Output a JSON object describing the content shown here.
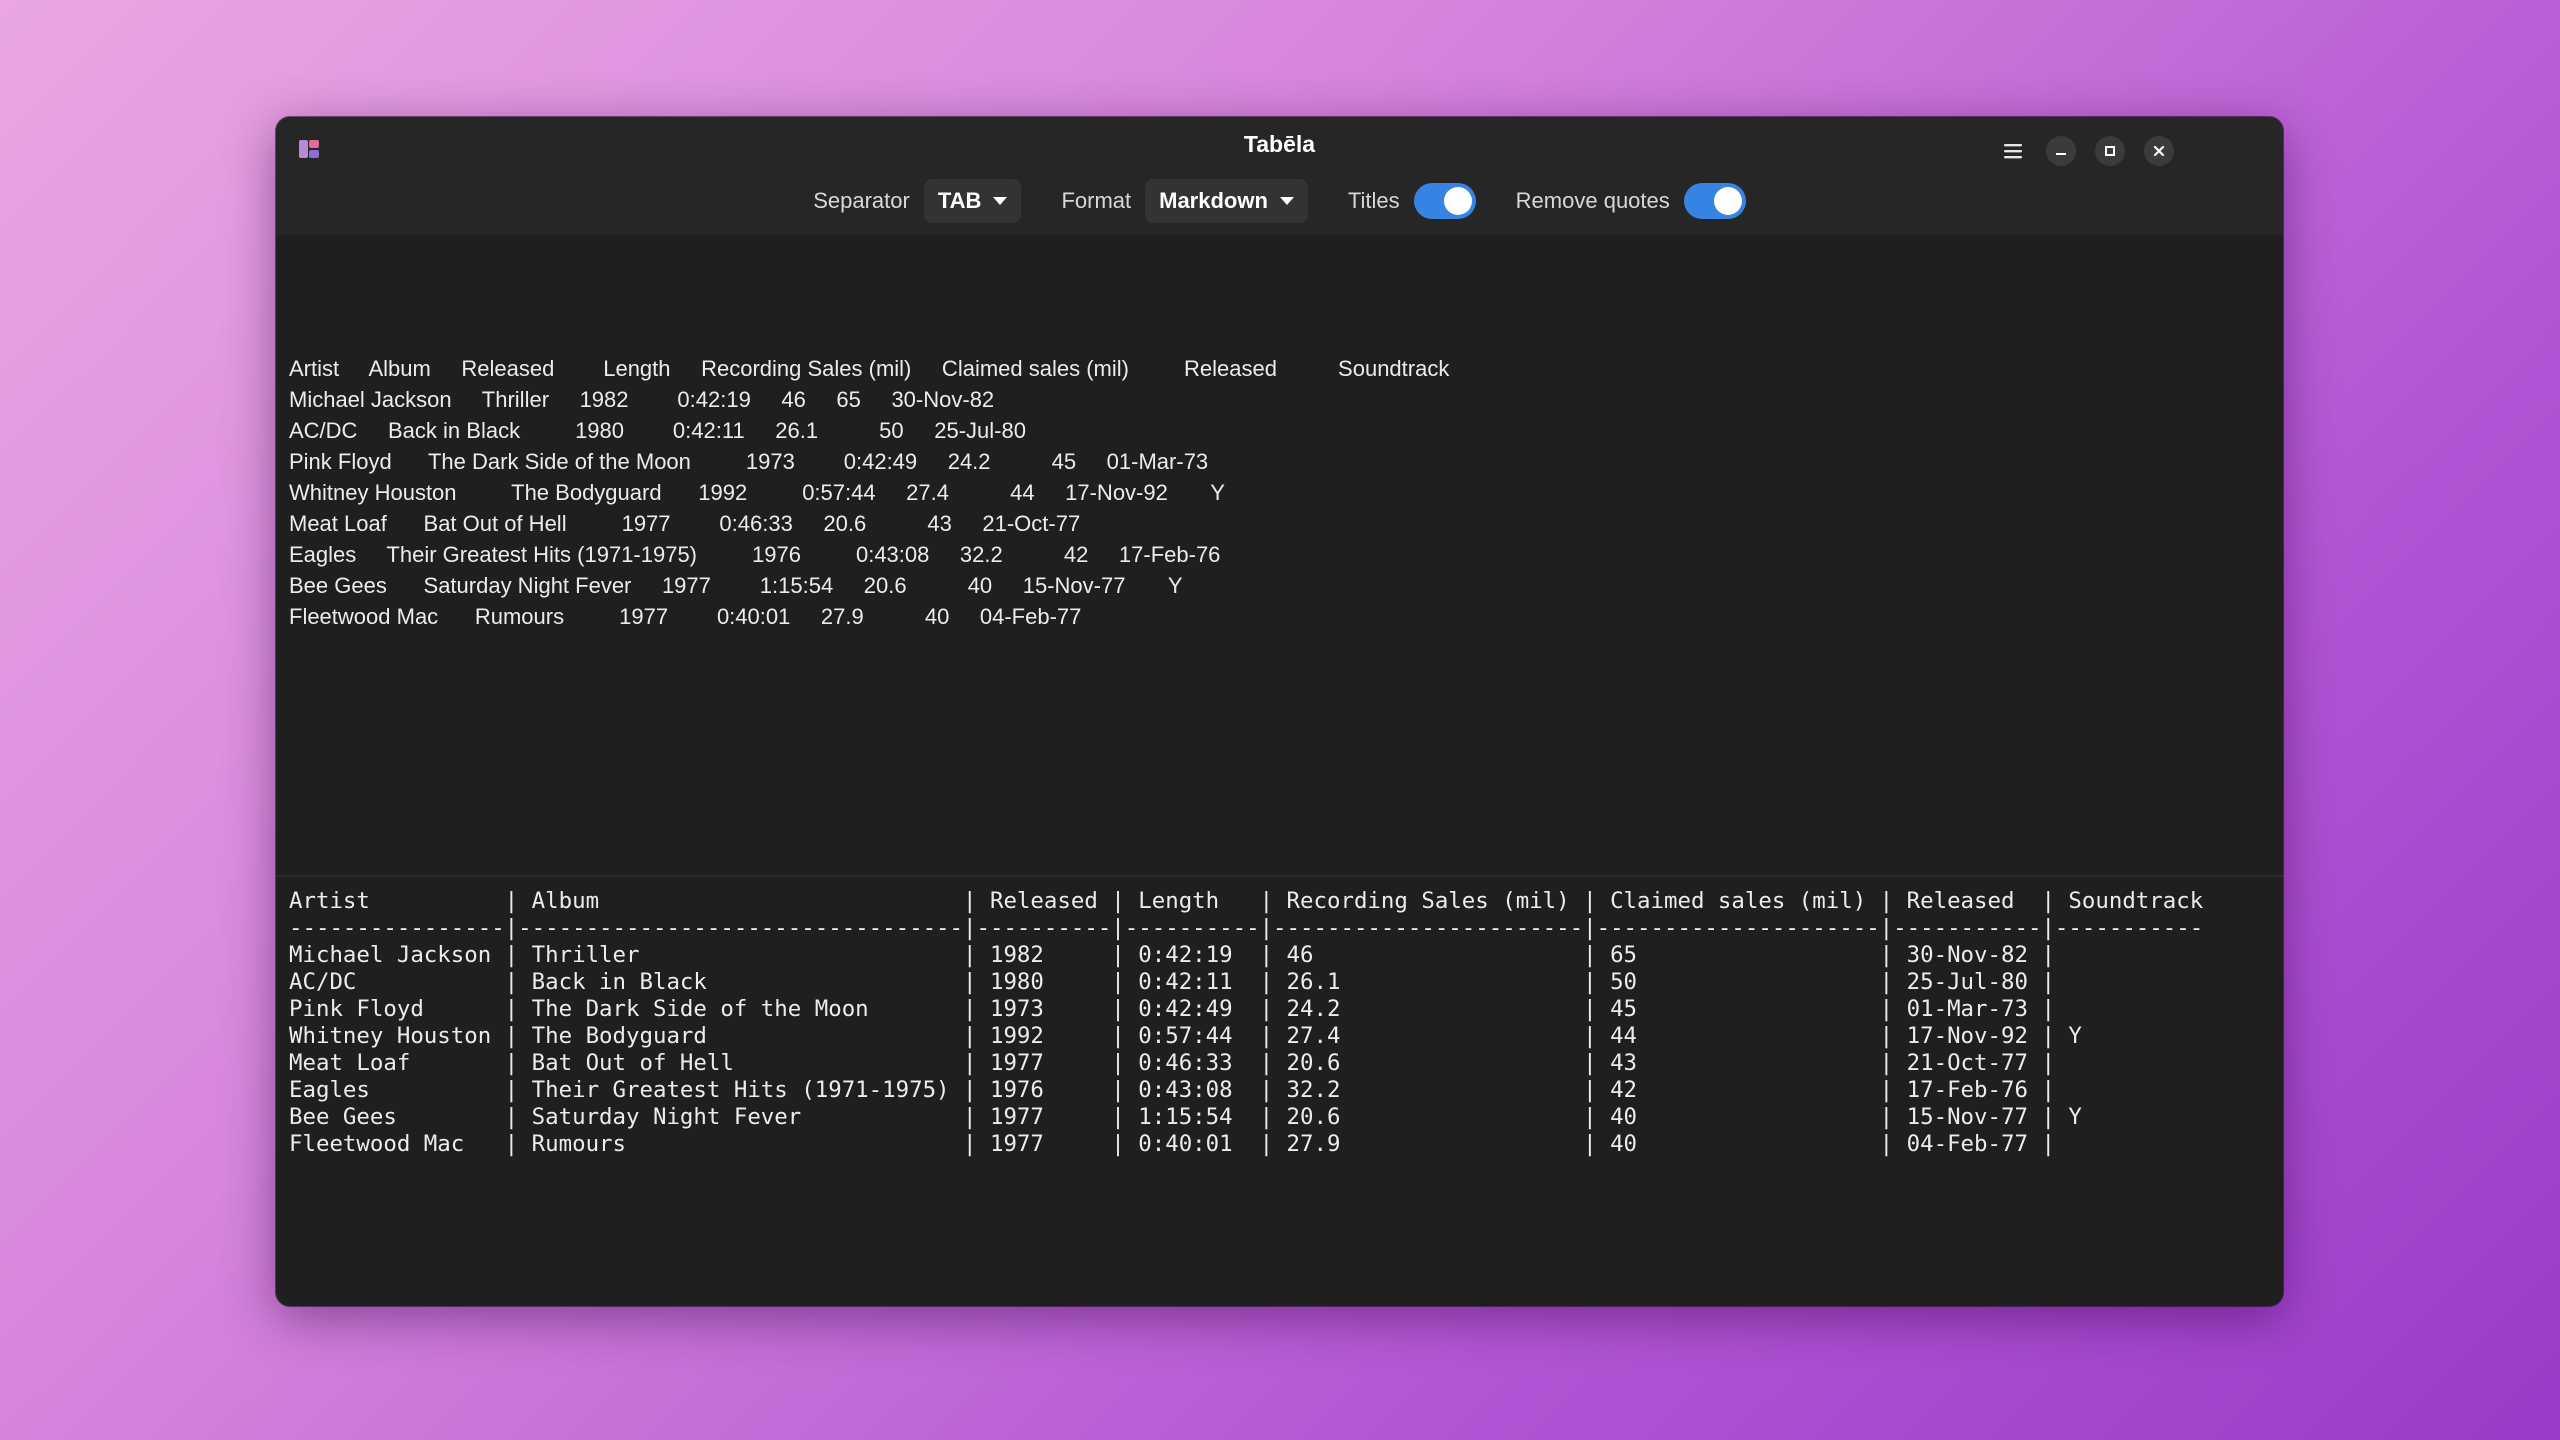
{
  "window": {
    "title": "Tabēla",
    "accent_color": "#3584e4"
  },
  "toolbar": {
    "separator_label": "Separator",
    "separator_value": "TAB",
    "format_label": "Format",
    "format_value": "Markdown",
    "titles_label": "Titles",
    "titles_on": true,
    "remove_quotes_label": "Remove quotes",
    "remove_quotes_on": true
  },
  "input": {
    "lines": [
      "Artist     Album     Released        Length     Recording Sales (mil)     Claimed sales (mil)         Released          Soundtrack",
      "Michael Jackson     Thriller     1982        0:42:19     46     65     30-Nov-82",
      "AC/DC     Back in Black         1980        0:42:11     26.1          50     25-Jul-80",
      "Pink Floyd      The Dark Side of the Moon         1973        0:42:49     24.2          45     01-Mar-73",
      "Whitney Houston         The Bodyguard      1992         0:57:44     27.4          44     17-Nov-92       Y",
      "Meat Loaf      Bat Out of Hell         1977        0:46:33     20.6          43     21-Oct-77",
      "Eagles     Their Greatest Hits (1971-1975)         1976         0:43:08     32.2          42     17-Feb-76",
      "Bee Gees      Saturday Night Fever     1977        1:15:54     20.6          40     15-Nov-77       Y",
      "Fleetwood Mac      Rumours         1977        0:40:01     27.9          40     04-Feb-77"
    ]
  },
  "output": {
    "lines": [
      "Artist          | Album                           | Released | Length   | Recording Sales (mil) | Claimed sales (mil) | Released  | Soundtrack",
      "----------------|---------------------------------|----------|----------|-----------------------|---------------------|-----------|-----------",
      "Michael Jackson | Thriller                        | 1982     | 0:42:19  | 46                    | 65                  | 30-Nov-82 |",
      "AC/DC           | Back in Black                   | 1980     | 0:42:11  | 26.1                  | 50                  | 25-Jul-80 |",
      "Pink Floyd      | The Dark Side of the Moon       | 1973     | 0:42:49  | 24.2                  | 45                  | 01-Mar-73 |",
      "Whitney Houston | The Bodyguard                   | 1992     | 0:57:44  | 27.4                  | 44                  | 17-Nov-92 | Y",
      "Meat Loaf       | Bat Out of Hell                 | 1977     | 0:46:33  | 20.6                  | 43                  | 21-Oct-77 |",
      "Eagles          | Their Greatest Hits (1971-1975) | 1976     | 0:43:08  | 32.2                  | 42                  | 17-Feb-76 |",
      "Bee Gees        | Saturday Night Fever            | 1977     | 1:15:54  | 20.6                  | 40                  | 15-Nov-77 | Y",
      "Fleetwood Mac   | Rumours                         | 1977     | 0:40:01  | 27.9                  | 40                  | 04-Feb-77 |"
    ]
  }
}
